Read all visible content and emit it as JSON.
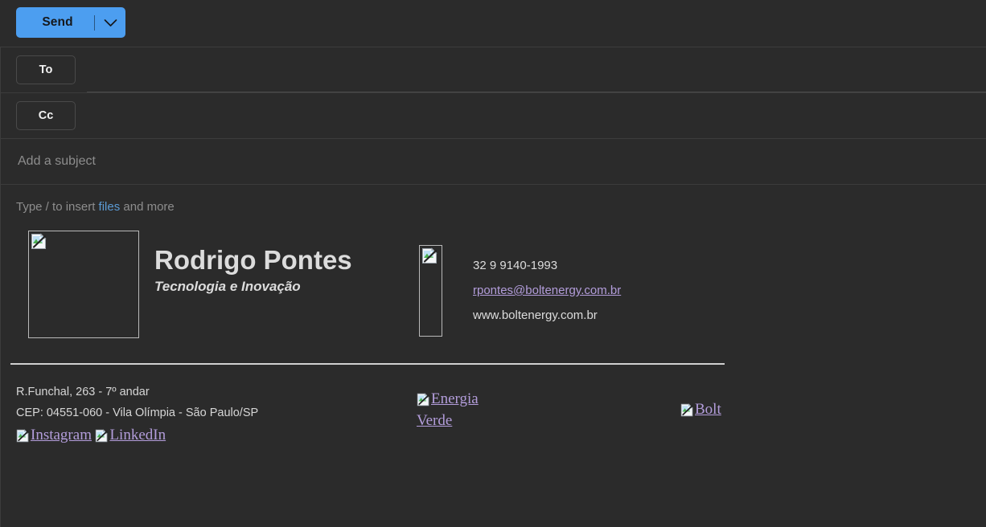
{
  "window": {
    "title": "New message compose",
    "theme": "dark",
    "background_color": "#2b2b2b",
    "accent_color": "#4c9ef0",
    "link_color": "#5b9bd5",
    "visited_link_color": "#b39ddb"
  },
  "toolbar": {
    "send_label": "Send",
    "send_dropdown_icon": "chevron-down-icon"
  },
  "fields": {
    "to": {
      "label": "To",
      "value": "",
      "placeholder": ""
    },
    "cc": {
      "label": "Cc",
      "value": "",
      "placeholder": ""
    },
    "subject": {
      "value": "",
      "placeholder": "Add a subject"
    }
  },
  "body": {
    "hint_prefix": "Type / to insert ",
    "hint_link": "files",
    "hint_suffix": " and more"
  },
  "signature": {
    "photo_placeholder_icon": "broken-image-icon",
    "name": "Rodrigo Pontes",
    "role": "Tecnologia e Inovação",
    "logo_placeholder_icon": "broken-image-icon",
    "contact": {
      "phone": "32 9 9140-1993",
      "email": "rpontes@boltenergy.com.br",
      "website": "www.boltenergy.com.br"
    },
    "address": {
      "line1": "R.Funchal, 263 - 7º andar",
      "line2": "CEP: 04551-060 - Vila Olímpia - São Paulo/SP"
    },
    "social": [
      {
        "alt": "Instagram",
        "icon": "broken-image-icon"
      },
      {
        "alt": "LinkedIn",
        "icon": "broken-image-icon"
      }
    ],
    "badges": [
      {
        "alt": "Energia Verde",
        "icon": "broken-image-icon"
      },
      {
        "alt": "Bolt",
        "icon": "broken-image-icon"
      }
    ]
  }
}
